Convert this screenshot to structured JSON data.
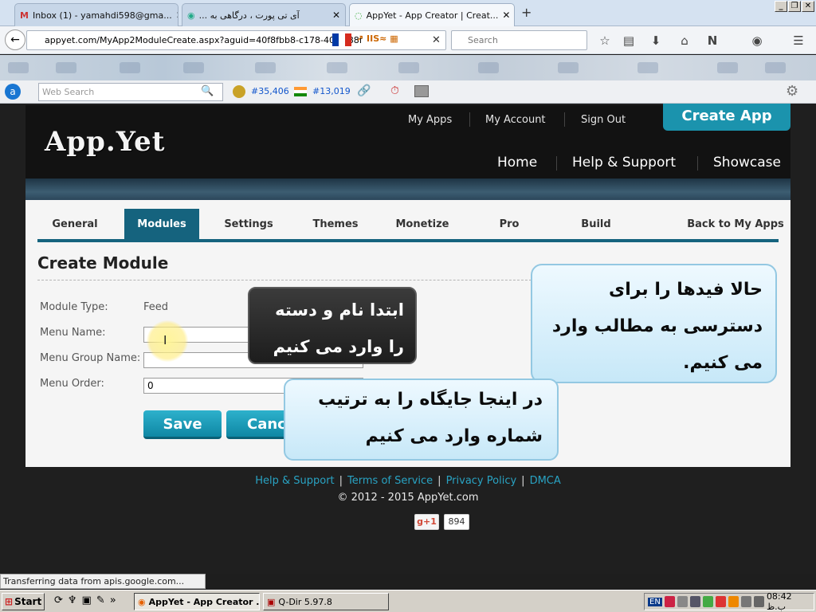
{
  "browser": {
    "tabs": [
      {
        "label": "Inbox (1) - yamahdi598@gma...",
        "icon": "gmail-icon"
      },
      {
        "label": "آی تی پورت ، درگاهی به ...",
        "icon": "chrome-icon"
      },
      {
        "label": "AppYet - App Creator | Creat...",
        "icon": "loading-icon"
      }
    ],
    "new_tab": "+",
    "url": "appyet.com/MyApp2ModuleCreate.aspx?aguid=40f8fbb8-c178-40ca-88f",
    "search_placeholder": "Search",
    "websearch_placeholder": "Web Search",
    "rank1": "#35,406",
    "rank2": "#13,019"
  },
  "site": {
    "logo": "App.Yet",
    "top_links": [
      "My Apps",
      "My Account",
      "Sign Out"
    ],
    "create_app": "Create App",
    "main_nav": [
      "Home",
      "Help & Support",
      "Showcase"
    ],
    "tabs": [
      "General",
      "Modules",
      "Settings",
      "Themes",
      "Monetize",
      "Pro",
      "Build",
      "Back to My Apps"
    ],
    "active_tab": "Modules"
  },
  "form": {
    "title": "Create Module",
    "module_type_label": "Module Type:",
    "module_type_value": "Feed",
    "menu_name_label": "Menu Name:",
    "menu_name_value": "",
    "menu_group_label": "Menu Group Name:",
    "menu_group_value": "",
    "menu_order_label": "Menu Order:",
    "menu_order_value": "0",
    "save": "Save",
    "cancel": "Cancel"
  },
  "annotations": {
    "dark": [
      "ابتدا نام و دسته",
      "را وارد می کنیم"
    ],
    "right": [
      "حالا فیدها را برای",
      "دسترسی به مطالب وارد",
      "می کنیم."
    ],
    "bottom": [
      "در اینجا جایگاه را به ترتیب",
      "شماره وارد می کنیم"
    ]
  },
  "footer": {
    "links": [
      "Help & Support",
      "Terms of Service",
      "Privacy Policy",
      "DMCA"
    ],
    "copyright": "© 2012 - 2015 AppYet.com",
    "gplus": "g+1",
    "gplus_count": "894"
  },
  "status": "Transferring data from apis.google.com...",
  "taskbar": {
    "start": "Start",
    "tasks": [
      "AppYet - App Creator ...",
      "Q-Dir 5.97.8"
    ],
    "lang": "EN",
    "clock": "08:42 ب.ظ"
  },
  "colors": {
    "accent": "#15637e",
    "button": "#1b93ad",
    "link": "#29a3c3"
  }
}
